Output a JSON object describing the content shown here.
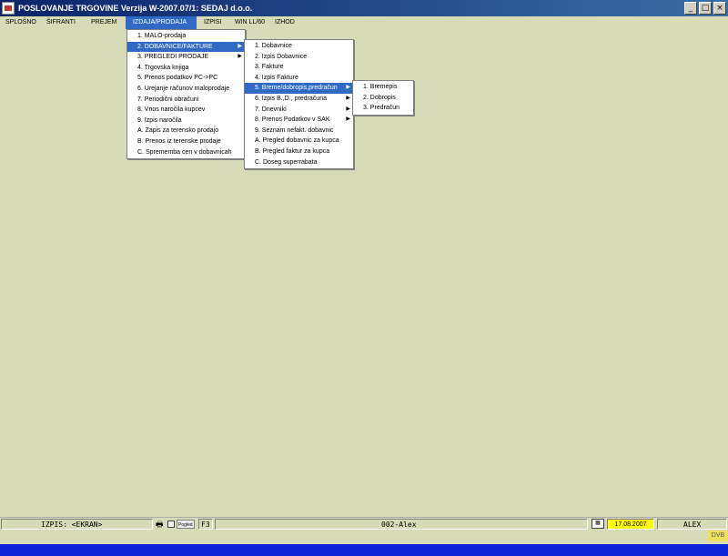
{
  "window": {
    "title": "POSLOVANJE TRGOVINE Verzija W-2007.07/1: SEDAJ d.o.o.",
    "buttons": {
      "minimize": "_",
      "maximize": "□",
      "close": "×"
    }
  },
  "menubar": {
    "items": [
      "SPLOŠNO",
      "ŠIFRANTI",
      "PREJEM",
      "IZDAJA/PRODAJA",
      "IZPISI",
      "WIN LL/60",
      "IZHOD"
    ]
  },
  "menu_izdaja": {
    "items": [
      "1. MALO-prodaja",
      "2. DOBAVNICE/FAKTURE",
      "3. PREGLEDI PRODAJE",
      "4. Trgovska knjiga",
      "5. Prenos podatkov PC->PC",
      "6. Urejanje računov maloprodaje",
      "7. Periodični obračuni",
      "8. Vnos naročila kupcev",
      "9. Izpis naročila",
      "A. Zapis za terensko prodajo",
      "B. Prenos iz terenske prodaje",
      "C. Sprememba cen v dobavnicah"
    ]
  },
  "menu_dobavnice": {
    "items": [
      "1. Dobavnice",
      "2. Izpis Dobavnice",
      "3. Fakture",
      "4. Izpis Fakture",
      "5. Breme/dobropis,predračun",
      "6. Izpis B.,D., predračuna",
      "7. Dnevniki",
      "8. Prenos Podatkov v SAK",
      "9. Seznam nefakt. dobavnic",
      "A. Pregled dobavnic za kupca",
      "B. Pregled faktur za kupca",
      "C. Doseg superrabata"
    ]
  },
  "menu_breme": {
    "items": [
      "1. Bremepis",
      "2. Dobropis",
      "3. Predračun"
    ]
  },
  "statusbar": {
    "izpis": "IZPIS: <EKRAN>",
    "pogled": "Pogled",
    "f3": "F3",
    "user_code": "002-Alex",
    "date": "17.08.2007",
    "user": "ALEX",
    "dvb": "DVB"
  },
  "colors": {
    "background": "#d8dbb8",
    "highlight": "#316ac5",
    "date_bg": "#ffff00",
    "bottom_bar": "#0b22d8"
  }
}
